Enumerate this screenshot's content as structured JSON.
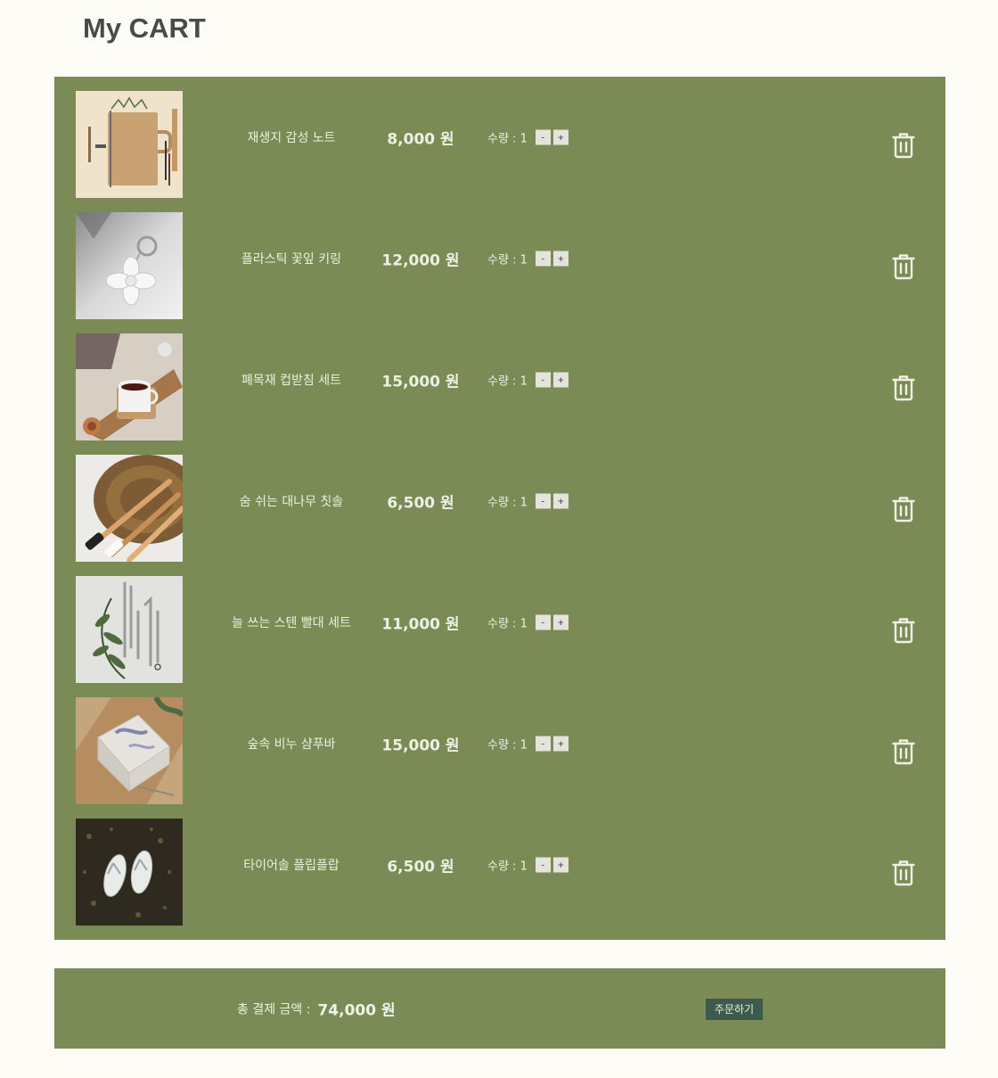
{
  "header": {
    "title": "My CART"
  },
  "cart": {
    "qty_label": "수량 : 1",
    "minus_label": "-",
    "plus_label": "+",
    "items": [
      {
        "name": "재생지 감성 노트",
        "price": "8,000 원",
        "image": "kraft-notebook-image"
      },
      {
        "name": "플라스틱 꽃잎 키링",
        "price": "12,000 원",
        "image": "flower-keyring-image"
      },
      {
        "name": "폐목재 컵받침 세트",
        "price": "15,000 원",
        "image": "wood-coaster-image"
      },
      {
        "name": "숨 쉬는 대나무 칫솔",
        "price": "6,500 원",
        "image": "bamboo-toothbrush-image"
      },
      {
        "name": "늘 쓰는 스텐 빨대 세트",
        "price": "11,000 원",
        "image": "steel-straw-image"
      },
      {
        "name": "숲속 비누 샴푸바",
        "price": "15,000 원",
        "image": "shampoo-bar-image"
      },
      {
        "name": "타이어솔 플립플랍",
        "price": "6,500 원",
        "image": "flip-flop-image"
      }
    ],
    "icons": {
      "delete": "trash-icon"
    }
  },
  "summary": {
    "total_label": "총 결제 금액 :",
    "total_value": "74,000 원",
    "order_button": "주문하기"
  },
  "colors": {
    "background": "#fdfcf7",
    "panel": "#7b8b55",
    "order_button": "#3c5a4d",
    "text_light": "#eef0e4"
  }
}
